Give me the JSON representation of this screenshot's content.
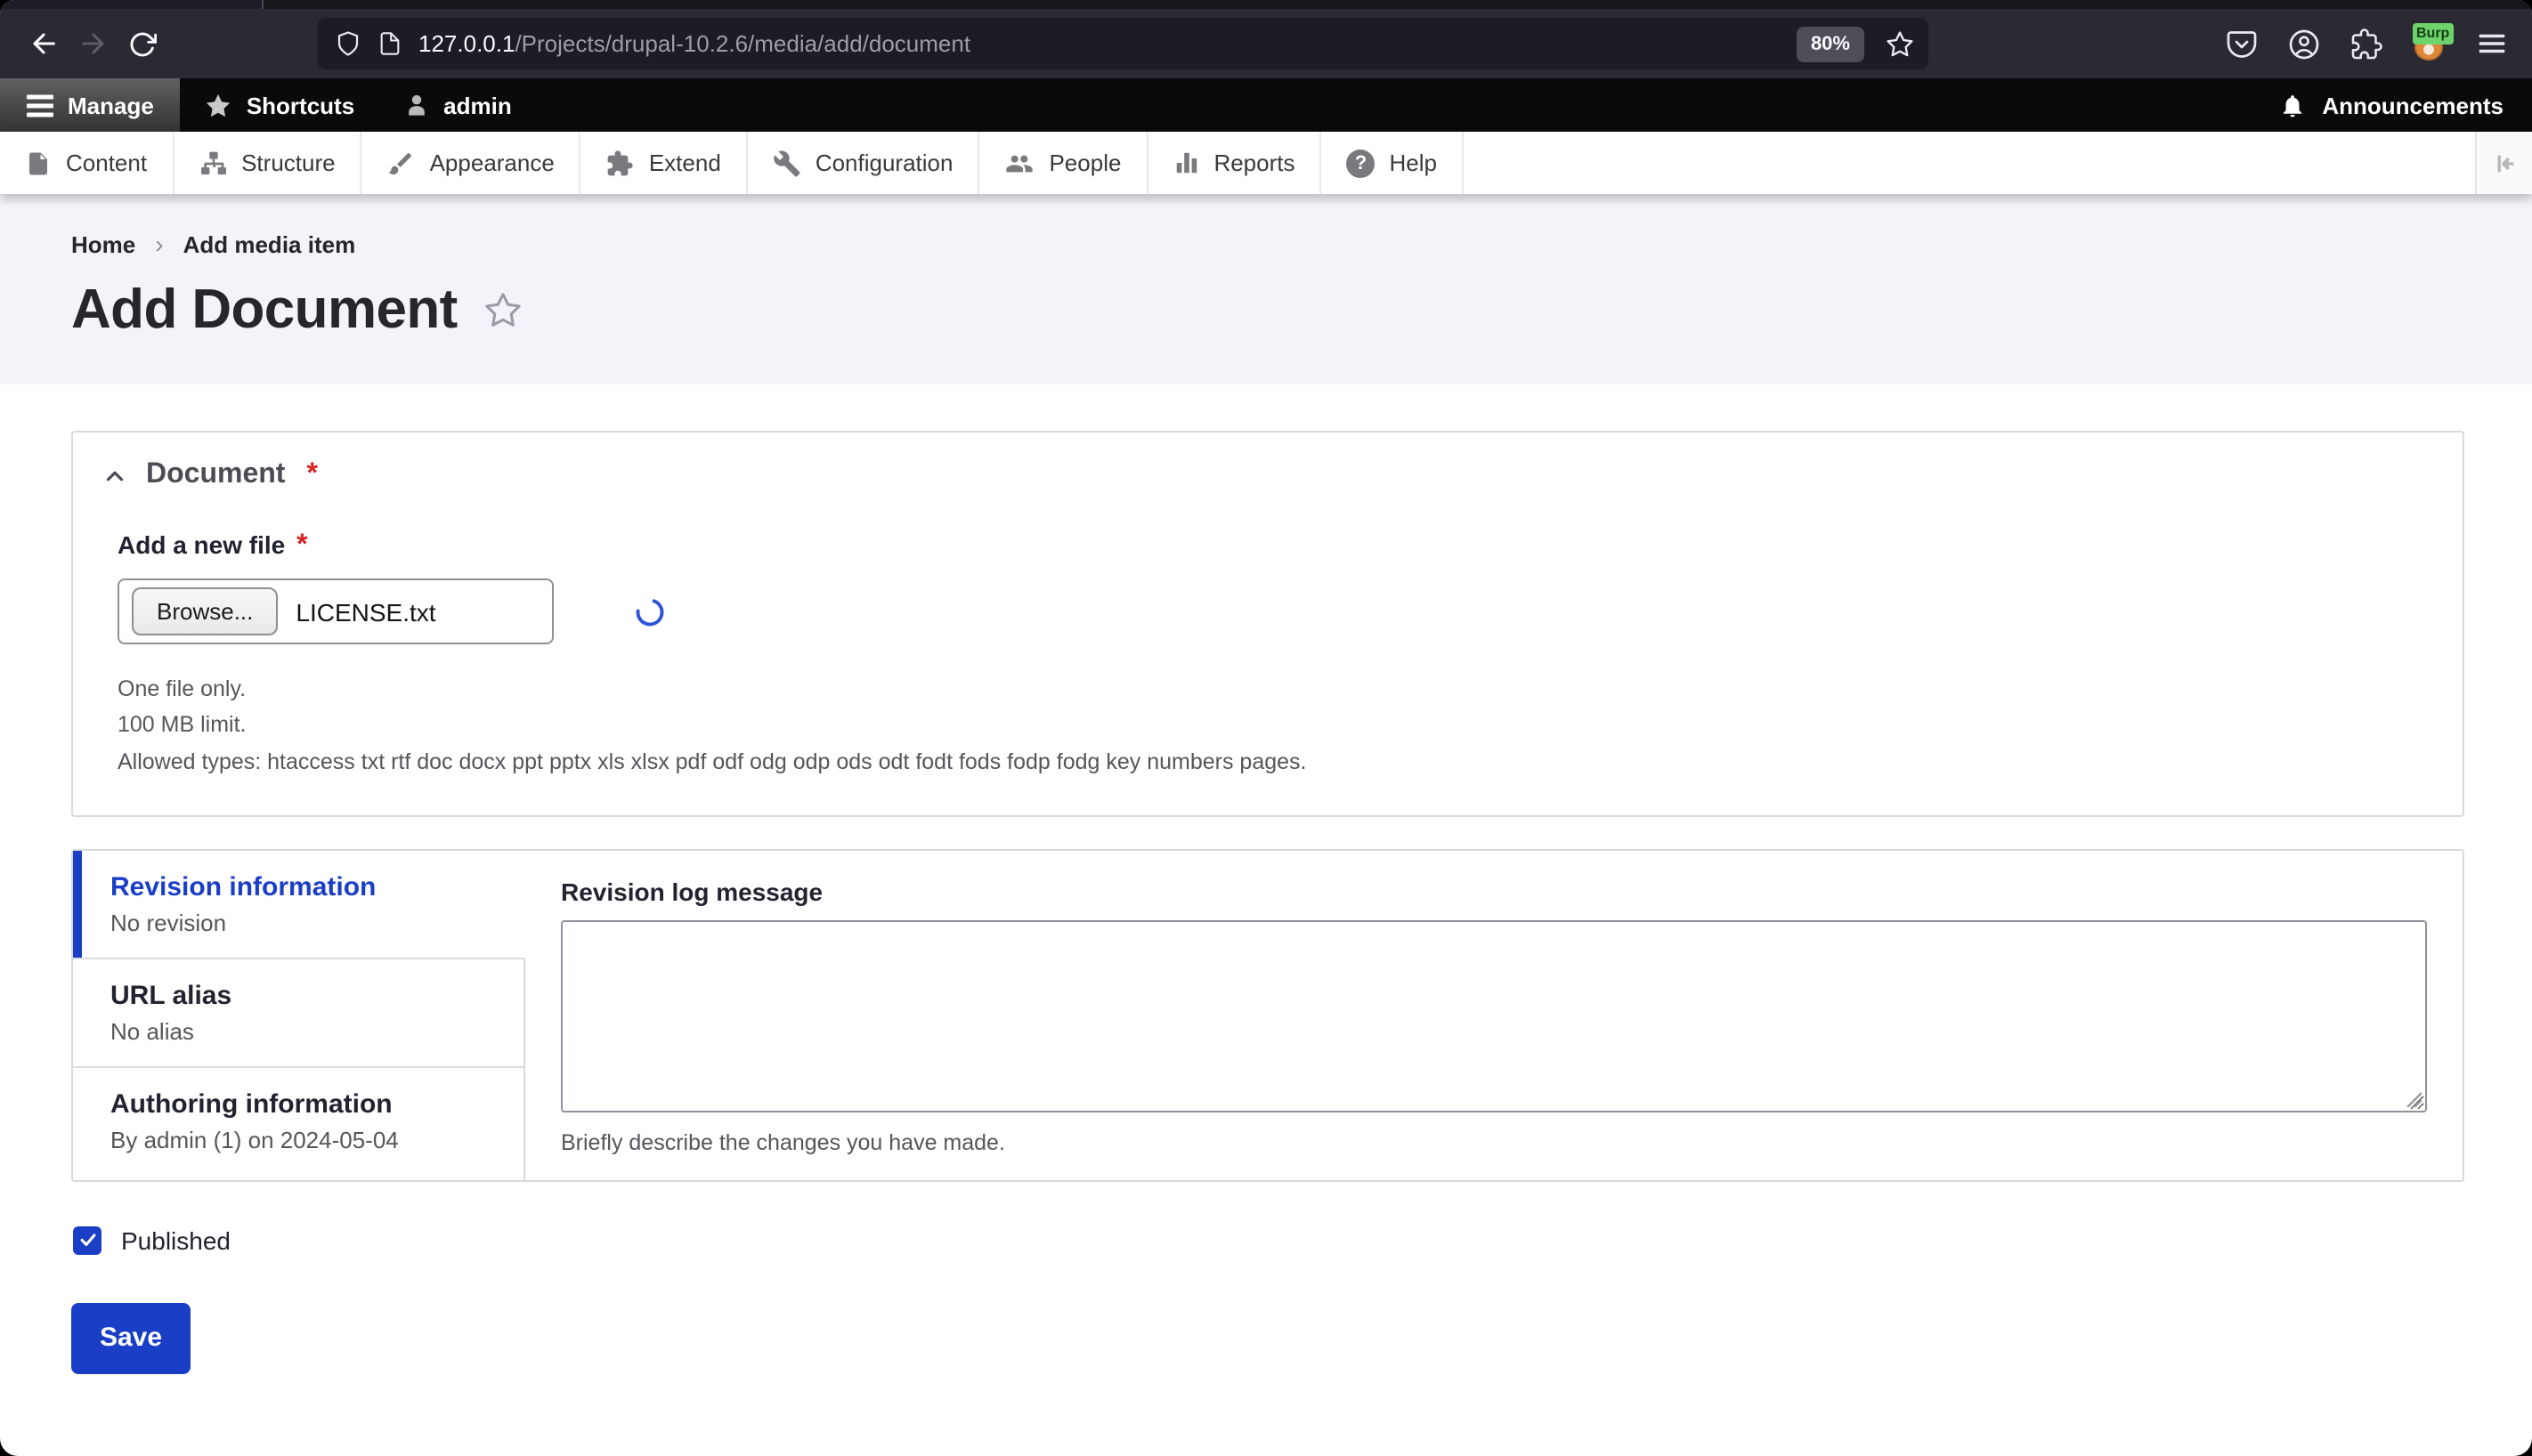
{
  "browser": {
    "url_host": "127.0.0.1",
    "url_path": "/Projects/drupal-10.2.6/media/add/document",
    "zoom_level": "80%",
    "extension_badge": "Burp"
  },
  "admin_toolbar": {
    "manage": "Manage",
    "shortcuts": "Shortcuts",
    "user": "admin",
    "announcements": "Announcements"
  },
  "menu": {
    "items": [
      {
        "label": "Content",
        "icon": "document-icon"
      },
      {
        "label": "Structure",
        "icon": "sitemap-icon"
      },
      {
        "label": "Appearance",
        "icon": "paintbrush-icon"
      },
      {
        "label": "Extend",
        "icon": "puzzle-icon"
      },
      {
        "label": "Configuration",
        "icon": "wrench-icon"
      },
      {
        "label": "People",
        "icon": "people-icon"
      },
      {
        "label": "Reports",
        "icon": "bar-chart-icon"
      },
      {
        "label": "Help",
        "icon": "question-icon"
      }
    ],
    "help_glyph": "?"
  },
  "breadcrumb": {
    "items": [
      {
        "label": "Home"
      },
      {
        "label": "Add media item"
      }
    ]
  },
  "page": {
    "title": "Add Document"
  },
  "document_section": {
    "legend": "Document",
    "required_marker": "*",
    "file_field": {
      "label": "Add a new file",
      "required_marker": "*",
      "browse_label": "Browse...",
      "filename": "LICENSE.txt",
      "descriptions": [
        "One file only.",
        "100 MB limit.",
        "Allowed types: htaccess txt rtf doc docx ppt pptx xls xlsx pdf odf odg odp ods odt fodt fods fodp fodg key numbers pages."
      ]
    }
  },
  "sidebar_tabs": {
    "tabs": [
      {
        "label": "Revision information",
        "summary": "No revision",
        "active": true
      },
      {
        "label": "URL alias",
        "summary": "No alias",
        "active": false
      },
      {
        "label": "Authoring information",
        "summary": "By admin (1) on 2024-05-04",
        "active": false
      }
    ]
  },
  "revision_panel": {
    "label": "Revision log message",
    "textarea_value": "",
    "description": "Briefly describe the changes you have made."
  },
  "publish": {
    "label": "Published",
    "checked": true
  },
  "actions": {
    "save_label": "Save"
  },
  "colors": {
    "accent": "#1b3ec6",
    "danger": "#d72222",
    "chrome_dark": "#2b2a33"
  }
}
